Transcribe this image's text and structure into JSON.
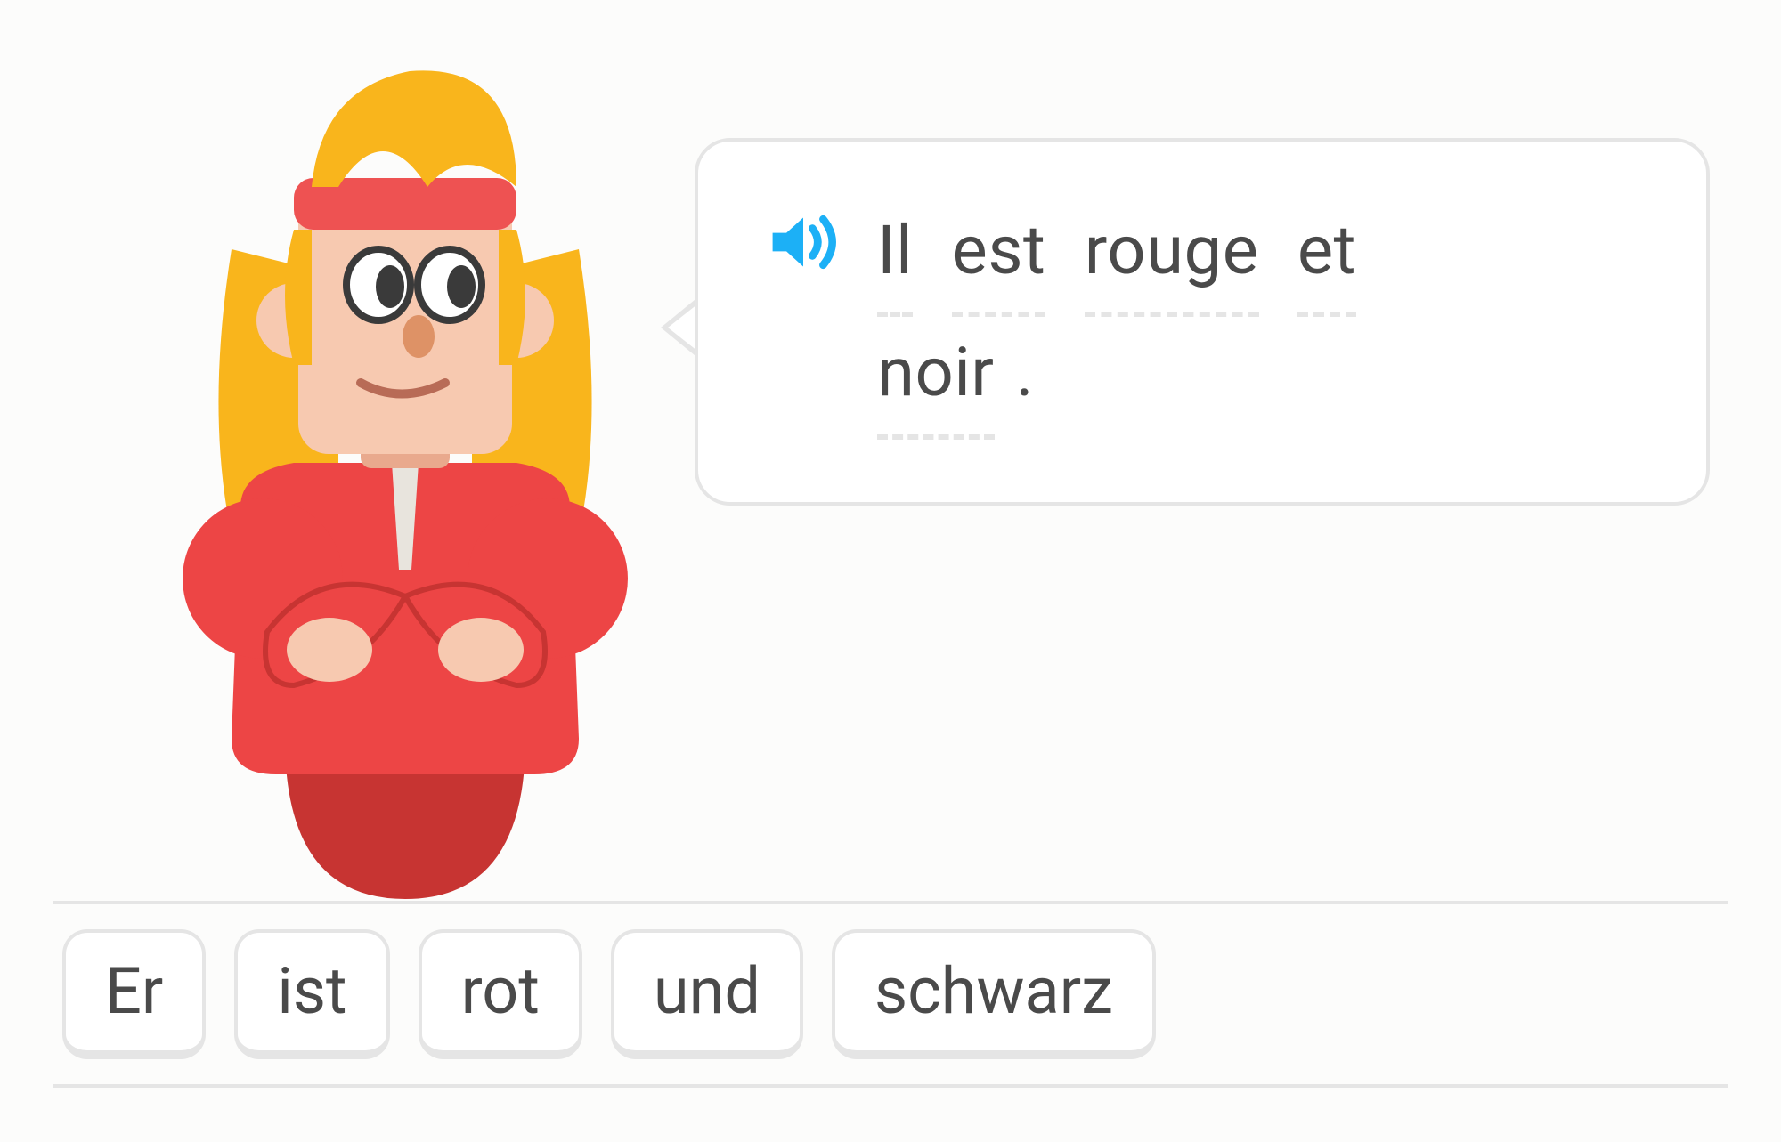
{
  "character": {
    "name": "bea-character",
    "palette": {
      "skin": "#f7c9b0",
      "skin_shadow": "#e9a98d",
      "hair": "#f9b51c",
      "headband": "#ee5252",
      "jacket": "#ed4545",
      "jacket_dark": "#c73432",
      "zipper": "#e8e4dd",
      "eye_white": "#ffffff",
      "eye_dark": "#3a3a3a",
      "nose": "#de9266",
      "mouth": "#b86b56"
    }
  },
  "speech": {
    "audio_icon": "speaker-icon",
    "words": [
      "Il",
      "est",
      "rouge",
      "et",
      "noir"
    ],
    "trailing_punct": "."
  },
  "answer_tiles": [
    "Er",
    "ist",
    "rot",
    "und",
    "schwarz"
  ],
  "colors": {
    "speaker_blue": "#1cb0f6",
    "border_gray": "#e5e5e5",
    "text_gray": "#4a4a4a"
  }
}
